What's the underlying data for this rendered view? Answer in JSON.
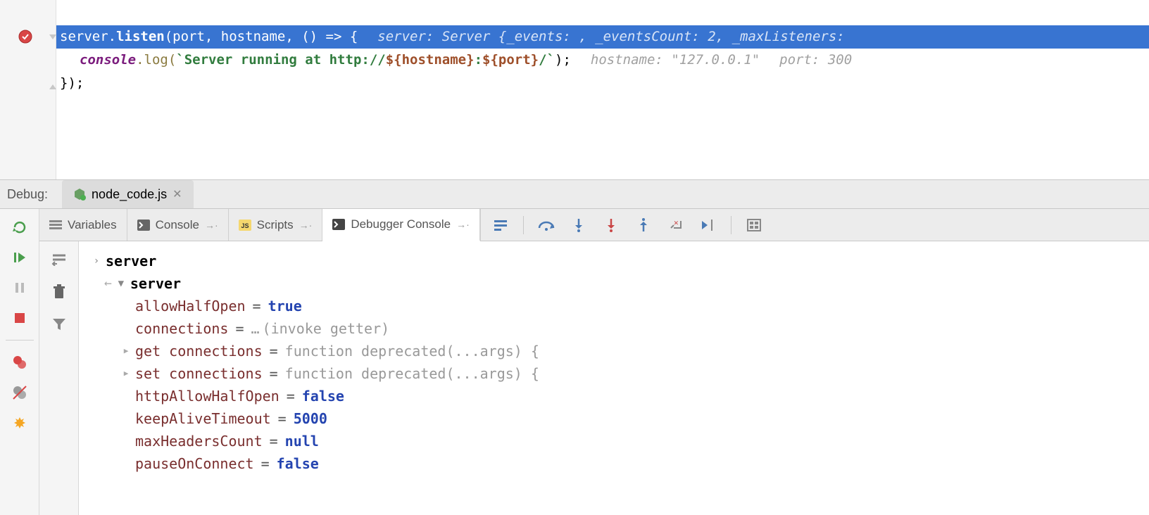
{
  "editor": {
    "line1": {
      "obj": "server",
      "method": "listen",
      "args": "(port, hostname, () => {",
      "hint": "server: Server {_events: , _eventsCount: 2, _maxListeners:"
    },
    "line2": {
      "console": "console",
      "log": ".log(",
      "str1": "`Server running at http://",
      "tpl1": "${",
      "var1": "hostname",
      "tpl2": "}",
      "str2": ":",
      "tpl3": "${",
      "var2": "port",
      "tpl4": "}",
      "str3": "/`",
      "rest": ");",
      "hint1_label": "hostname:",
      "hint1_val": "\"127.0.0.1\"",
      "hint2_label": "port:",
      "hint2_val": "300"
    },
    "line3": "});"
  },
  "debug": {
    "label": "Debug:",
    "tab_name": "node_code.js"
  },
  "tabs": {
    "variables": "Variables",
    "console": "Console",
    "scripts": "Scripts",
    "debugger_console": "Debugger Console"
  },
  "console": {
    "root_prompt": "server",
    "root_name": "server",
    "props": [
      {
        "key": "allowHalfOpen",
        "eq": "=",
        "val": "true",
        "type": "bool"
      },
      {
        "key": "connections",
        "eq": "=",
        "dots": "…",
        "invoke": "(invoke getter)",
        "type": "getter"
      },
      {
        "key": "get connections",
        "eq": "=",
        "val": "function deprecated(...args) {",
        "type": "func",
        "arrow": true
      },
      {
        "key": "set connections",
        "eq": "=",
        "val": "function deprecated(...args) {",
        "type": "func",
        "arrow": true
      },
      {
        "key": "httpAllowHalfOpen",
        "eq": "=",
        "val": "false",
        "type": "bool"
      },
      {
        "key": "keepAliveTimeout",
        "eq": "=",
        "val": "5000",
        "type": "num"
      },
      {
        "key": "maxHeadersCount",
        "eq": "=",
        "val": "null",
        "type": "null"
      },
      {
        "key": "pauseOnConnect",
        "eq": "=",
        "val": "false",
        "type": "bool"
      }
    ]
  }
}
